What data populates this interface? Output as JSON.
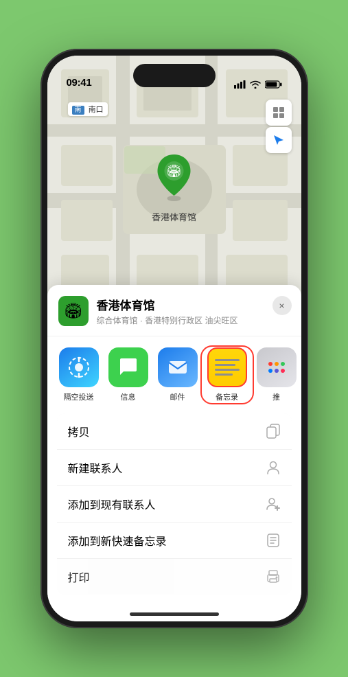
{
  "status_bar": {
    "time": "09:41",
    "signal_icon": "signal",
    "wifi_icon": "wifi",
    "battery_icon": "battery"
  },
  "map": {
    "label": "南口",
    "marker_label": "香港体育馆",
    "marker_emoji": "🏟"
  },
  "map_controls": {
    "map_view_icon": "🗺",
    "location_icon": "➤"
  },
  "place_info": {
    "name": "香港体育馆",
    "subtitle": "综合体育馆 · 香港特别行政区 油尖旺区",
    "close_label": "×",
    "icon_emoji": "🏟"
  },
  "share_apps": [
    {
      "id": "airdrop",
      "label": "隔空投送",
      "type": "airdrop"
    },
    {
      "id": "messages",
      "label": "信息",
      "type": "messages"
    },
    {
      "id": "mail",
      "label": "邮件",
      "type": "mail"
    },
    {
      "id": "notes",
      "label": "备忘录",
      "type": "notes"
    },
    {
      "id": "more",
      "label": "推",
      "type": "more"
    }
  ],
  "actions": [
    {
      "id": "copy",
      "label": "拷贝",
      "icon": "copy"
    },
    {
      "id": "new-contact",
      "label": "新建联系人",
      "icon": "person"
    },
    {
      "id": "add-existing",
      "label": "添加到现有联系人",
      "icon": "person-add"
    },
    {
      "id": "add-notes",
      "label": "添加到新快速备忘录",
      "icon": "memo"
    },
    {
      "id": "print",
      "label": "打印",
      "icon": "printer"
    }
  ],
  "colors": {
    "green": "#2d9e2d",
    "red": "#ff3b30",
    "blue": "#1c7ceb"
  }
}
